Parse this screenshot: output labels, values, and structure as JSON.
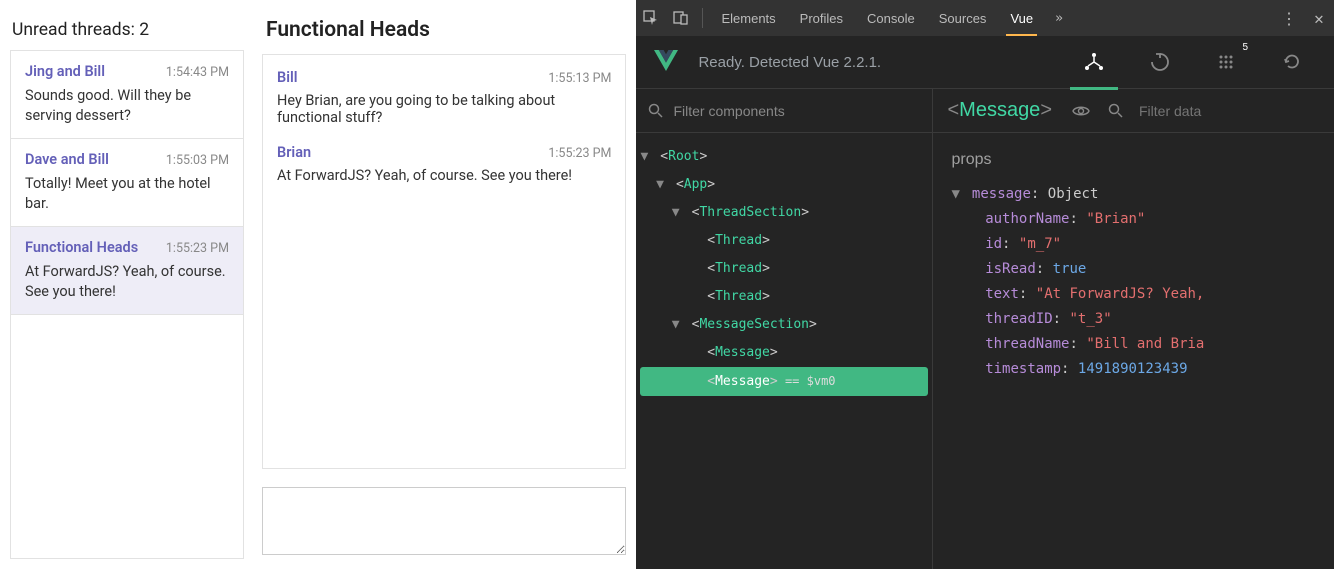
{
  "app": {
    "unread_label": "Unread threads: 2",
    "threads": [
      {
        "name": "Jing and Bill",
        "time": "1:54:43 PM",
        "snippet": "Sounds good. Will they be serving dessert?",
        "selected": false
      },
      {
        "name": "Dave and Bill",
        "time": "1:55:03 PM",
        "snippet": "Totally! Meet you at the hotel bar.",
        "selected": false
      },
      {
        "name": "Functional Heads",
        "time": "1:55:23 PM",
        "snippet": "At ForwardJS? Yeah, of course. See you there!",
        "selected": true
      }
    ],
    "messages_title": "Functional Heads",
    "messages": [
      {
        "author": "Bill",
        "time": "1:55:13 PM",
        "text": "Hey Brian, are you going to be talking about functional stuff?"
      },
      {
        "author": "Brian",
        "time": "1:55:23 PM",
        "text": "At ForwardJS? Yeah, of course. See you there!"
      }
    ],
    "compose_placeholder": ""
  },
  "devtools": {
    "tabs": [
      "Elements",
      "Profiles",
      "Console",
      "Sources",
      "Vue"
    ],
    "active_tab": "Vue",
    "overflow": "»",
    "status": "Ready. Detected Vue 2.2.1.",
    "filter_components_placeholder": "Filter components",
    "filter_data_placeholder": "Filter data",
    "selected_component": "Message",
    "events_badge": "5",
    "tree": [
      {
        "indent": 0,
        "caret": "▼",
        "tag": "Root",
        "raw": false
      },
      {
        "indent": 1,
        "caret": "▼",
        "tag": "App",
        "raw": false
      },
      {
        "indent": 2,
        "caret": "▼",
        "tag": "ThreadSection",
        "raw": false
      },
      {
        "indent": 3,
        "caret": "",
        "tag": "Thread",
        "raw": false
      },
      {
        "indent": 3,
        "caret": "",
        "tag": "Thread",
        "raw": false
      },
      {
        "indent": 3,
        "caret": "",
        "tag": "Thread",
        "raw": false
      },
      {
        "indent": 2,
        "caret": "▼",
        "tag": "MessageSection",
        "raw": false
      },
      {
        "indent": 3,
        "caret": "",
        "tag": "Message",
        "raw": false
      },
      {
        "indent": 3,
        "caret": "",
        "tag": "Message",
        "raw": true,
        "suffix": " == $vm0"
      }
    ],
    "props_header": "props",
    "props": {
      "root_key": "message",
      "root_type": "Object",
      "entries": [
        {
          "key": "authorName",
          "type": "str",
          "val": "\"Brian\""
        },
        {
          "key": "id",
          "type": "str",
          "val": "\"m_7\""
        },
        {
          "key": "isRead",
          "type": "bool",
          "val": "true"
        },
        {
          "key": "text",
          "type": "str",
          "val": "\"At ForwardJS? Yeah,"
        },
        {
          "key": "threadID",
          "type": "str",
          "val": "\"t_3\""
        },
        {
          "key": "threadName",
          "type": "str",
          "val": "\"Bill and Bria"
        },
        {
          "key": "timestamp",
          "type": "num",
          "val": "1491890123439"
        }
      ]
    }
  },
  "colors": {
    "vue_green": "#41b883",
    "vue_tag": "#41d8a5",
    "accent_link": "#6460b8"
  }
}
